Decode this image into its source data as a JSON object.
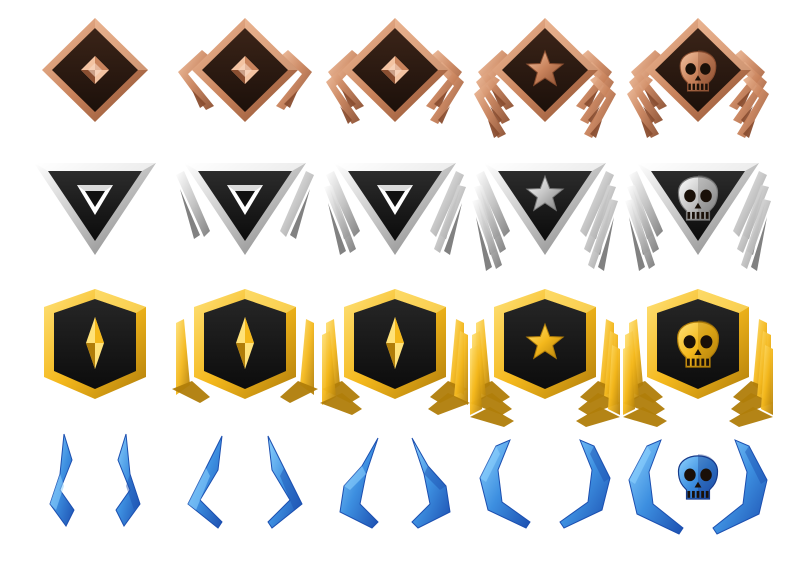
{
  "sheet": {
    "title": "",
    "tiers": [
      {
        "tier": "bronze",
        "frame": "diamond",
        "colors": {
          "light": "#f3c3a2",
          "mid": "#c9835c",
          "dark": "#8a4e30",
          "inner": "#3b2418",
          "innerDark": "#1c100a"
        },
        "ranks": [
          {
            "chevrons": 0,
            "emblem": "diamond-gem-icon"
          },
          {
            "chevrons": 1,
            "emblem": "diamond-gem-icon"
          },
          {
            "chevrons": 2,
            "emblem": "diamond-gem-icon"
          },
          {
            "chevrons": 3,
            "emblem": "star-icon"
          },
          {
            "chevrons": 3,
            "emblem": "skull-icon"
          }
        ]
      },
      {
        "tier": "silver",
        "frame": "triangle",
        "colors": {
          "light": "#ffffff",
          "mid": "#c2c2c2",
          "dark": "#7a7a7a",
          "inner": "#2c2c2c",
          "innerDark": "#0b0b0b"
        },
        "ranks": [
          {
            "chevrons": 0,
            "emblem": "triangle-gem-icon"
          },
          {
            "chevrons": 1,
            "emblem": "triangle-gem-icon"
          },
          {
            "chevrons": 2,
            "emblem": "triangle-gem-icon"
          },
          {
            "chevrons": 3,
            "emblem": "star-icon"
          },
          {
            "chevrons": 3,
            "emblem": "skull-icon"
          }
        ]
      },
      {
        "tier": "gold",
        "frame": "shield",
        "colors": {
          "light": "#ffe27a",
          "mid": "#f4b81c",
          "dark": "#b07d0a",
          "inner": "#262626",
          "innerDark": "#0c0c0c"
        },
        "ranks": [
          {
            "chevrons": 0,
            "emblem": "crystal-icon"
          },
          {
            "chevrons": 1,
            "emblem": "crystal-icon"
          },
          {
            "chevrons": 2,
            "emblem": "crystal-icon"
          },
          {
            "chevrons": 3,
            "emblem": "star-icon"
          },
          {
            "chevrons": 3,
            "emblem": "skull-icon"
          }
        ]
      },
      {
        "tier": "diamond",
        "frame": "wings",
        "colors": {
          "light": "#8fd3ff",
          "mid": "#3d8fe0",
          "dark": "#1c4fb0",
          "inner": "#1a3a8a",
          "innerDark": "#0e1f55"
        },
        "ranks": [
          {
            "chevrons": 0,
            "emblem": "wing-shard-icon"
          },
          {
            "chevrons": 1,
            "emblem": "wing-shard-icon"
          },
          {
            "chevrons": 2,
            "emblem": "wing-shard-icon"
          },
          {
            "chevrons": 3,
            "emblem": "wing-shard-icon"
          },
          {
            "chevrons": 3,
            "emblem": "skull-icon"
          }
        ]
      }
    ]
  }
}
